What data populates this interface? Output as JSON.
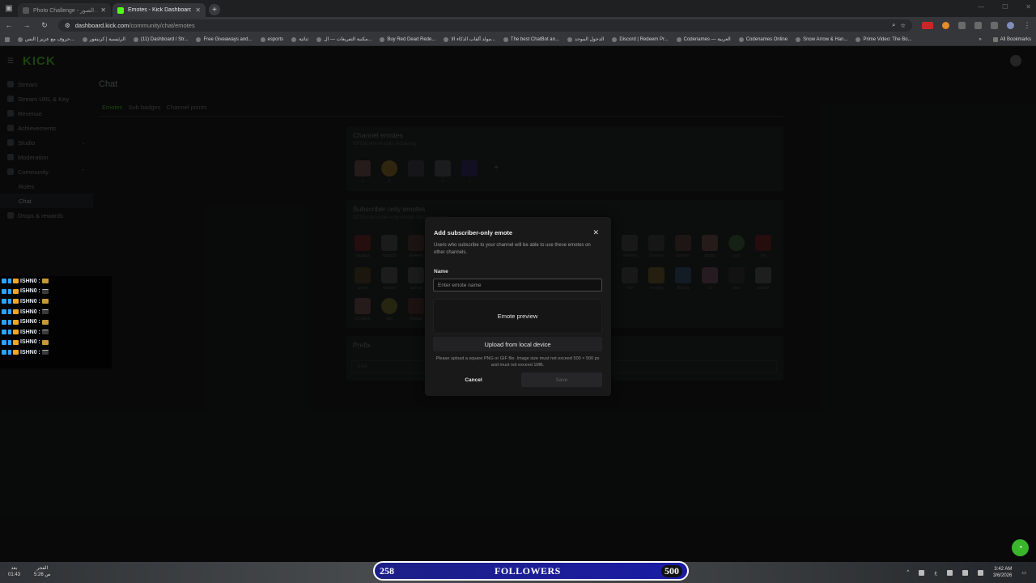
{
  "browser": {
    "tabs": [
      {
        "title": "Photo Challenge - تحدي الصور"
      },
      {
        "title": "Emotes - Kick Dashboard"
      }
    ],
    "url_domain": "dashboard.kick.com",
    "url_path": "/community/chat/emotes",
    "bookmarks": [
      "حروف مع عزيز | النس...",
      "الرئيسية | كرنيفور",
      "(11) Dashboard / Str...",
      "Free Giveaways and...",
      "esports",
      "ثنائية",
      "مكتبة التفريغات — ال...",
      "Buy Red Dead Rede...",
      "مولد ألقاب الذكاء الا...",
      "The best ChatBot an...",
      "الدخول الموحد",
      "Discord | Redeem Pr...",
      "Codenames — العربية",
      "Codenames Online",
      "Snow Arrow & Han...",
      "Prime Video: The Bo..."
    ],
    "all_bookmarks": "All Bookmarks"
  },
  "dashboard": {
    "logo": "KICK",
    "sidebar": [
      {
        "label": "Stream"
      },
      {
        "label": "Stream URL & Key"
      },
      {
        "label": "Revenue"
      },
      {
        "label": "Achievements"
      },
      {
        "label": "Studio"
      },
      {
        "label": "Moderation"
      },
      {
        "label": "Community"
      },
      {
        "label": "Roles"
      },
      {
        "label": "Chat"
      },
      {
        "label": "Drops & rewards"
      }
    ],
    "page_title": "Chat",
    "tabs": [
      "Emotes",
      "Sub badges",
      "Channel points"
    ],
    "channel_emotes": {
      "title": "Channel emotes",
      "subtitle": "95/100 emote slots remaining",
      "labels": [
        "x",
        "0",
        "",
        "x",
        "x"
      ]
    },
    "subscriber_emotes": {
      "title": "Subscriber-only emotes",
      "subtitle": "22/30 subscriber-only emote slots remaining",
      "labels": [
        "lukakaa",
        "lullsb28",
        "AAAAA",
        "dunkem",
        "dankem",
        "dankem",
        "dilapp",
        "solo",
        "fire",
        "grmm",
        "kanshe",
        "sannat",
        "mck",
        "monkey",
        "l626eg",
        "Oh",
        "poor",
        "sadcat",
        "Chadeth",
        "lala",
        "thagud"
      ]
    },
    "prefix": {
      "title": "Prefix",
      "value": "sllg4"
    }
  },
  "modal": {
    "title": "Add subscriber-only emote",
    "description": "Users who subscribe to your channel will be able to use these emotes on other channels.",
    "name_label": "Name",
    "name_placeholder": "Enter emote name",
    "preview_label": "Emote preview",
    "upload_label": "Upload from local device",
    "hint": "Please upload a square PNG or GIF file. Image size must not exceed 500 × 500 px and must not exceed 1MB.",
    "cancel_label": "Cancel",
    "save_label": "Save"
  },
  "chat_overlay": {
    "username": "ISHN0 :",
    "rows": 8
  },
  "stream_overlay": {
    "followers_current": "258",
    "followers_label": "FOLLOWERS",
    "followers_goal": "500"
  },
  "taskbar": {
    "left_line1": "بعد",
    "left_line2": "01:43",
    "left2_line1": "الفجر",
    "left2_line2": "5:26 ص",
    "time": "3:42 AM",
    "date": "3/6/2026",
    "lang": "ع"
  },
  "colors": {
    "kick_green": "#53fc18",
    "followers_bg": "#1a1ca4",
    "help_button": "#38b72a"
  }
}
